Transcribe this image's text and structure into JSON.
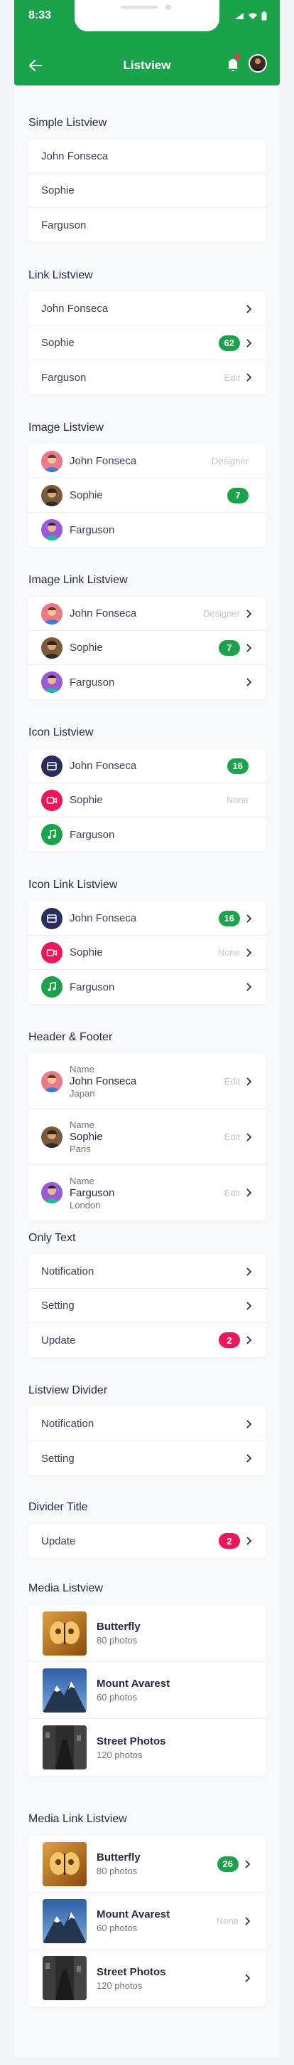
{
  "status": {
    "time": "8:33"
  },
  "header": {
    "title": "Listview"
  },
  "colors": {
    "accent": "#1aa34a",
    "badge_red": "#f0145a"
  },
  "sections": {
    "simple": {
      "title": "Simple Listview",
      "items": [
        "John Fonseca",
        "Sophie",
        "Farguson"
      ]
    },
    "link": {
      "title": "Link Listview",
      "items": [
        {
          "label": "John Fonseca"
        },
        {
          "label": "Sophie",
          "badge": "62"
        },
        {
          "label": "Farguson",
          "meta": "Edit"
        }
      ]
    },
    "image": {
      "title": "Image Listview",
      "items": [
        {
          "label": "John Fonseca",
          "meta": "Designer"
        },
        {
          "label": "Sophie",
          "badge": "7"
        },
        {
          "label": "Farguson"
        }
      ]
    },
    "image_link": {
      "title": "Image Link Listview",
      "items": [
        {
          "label": "John Fonseca",
          "meta": "Designer"
        },
        {
          "label": "Sophie",
          "badge": "7"
        },
        {
          "label": "Farguson"
        }
      ]
    },
    "icon": {
      "title": "Icon Listview",
      "items": [
        {
          "label": "John Fonseca",
          "badge": "16",
          "icon": "archive-icon"
        },
        {
          "label": "Sophie",
          "meta": "None",
          "icon": "video-icon"
        },
        {
          "label": "Farguson",
          "icon": "music-icon"
        }
      ]
    },
    "icon_link": {
      "title": "Icon Link Listview",
      "items": [
        {
          "label": "John Fonseca",
          "badge": "16",
          "icon": "archive-icon"
        },
        {
          "label": "Sophie",
          "meta": "None",
          "icon": "video-icon"
        },
        {
          "label": "Farguson",
          "icon": "music-icon"
        }
      ]
    },
    "header_footer": {
      "title": "Header & Footer",
      "items": [
        {
          "header": "Name",
          "label": "John Fonseca",
          "footer": "Japan",
          "meta": "Edit"
        },
        {
          "header": "Name",
          "label": "Sophie",
          "footer": "Paris",
          "meta": "Edit"
        },
        {
          "header": "Name",
          "label": "Farguson",
          "footer": "London",
          "meta": "Edit"
        }
      ]
    },
    "only_text": {
      "title": "Only Text",
      "items": [
        {
          "label": "Notification"
        },
        {
          "label": "Setting"
        },
        {
          "label": "Update",
          "badge": "2"
        }
      ]
    },
    "divider": {
      "title": "Listview Divider",
      "items": [
        {
          "label": "Notification"
        },
        {
          "label": "Setting"
        }
      ]
    },
    "divider_title": {
      "title": "Divider Title",
      "items": [
        {
          "label": "Update",
          "badge": "2"
        }
      ]
    },
    "media": {
      "title": "Media Listview",
      "items": [
        {
          "title": "Butterfly",
          "sub": "80 photos"
        },
        {
          "title": "Mount Avarest",
          "sub": "60 photos"
        },
        {
          "title": "Street Photos",
          "sub": "120 photos"
        }
      ]
    },
    "media_link": {
      "title": "Media Link Listview",
      "items": [
        {
          "title": "Butterfly",
          "sub": "80 photos",
          "badge": "26"
        },
        {
          "title": "Mount Avarest",
          "sub": "60 photos",
          "meta": "None"
        },
        {
          "title": "Street Photos",
          "sub": "120 photos"
        }
      ]
    }
  }
}
